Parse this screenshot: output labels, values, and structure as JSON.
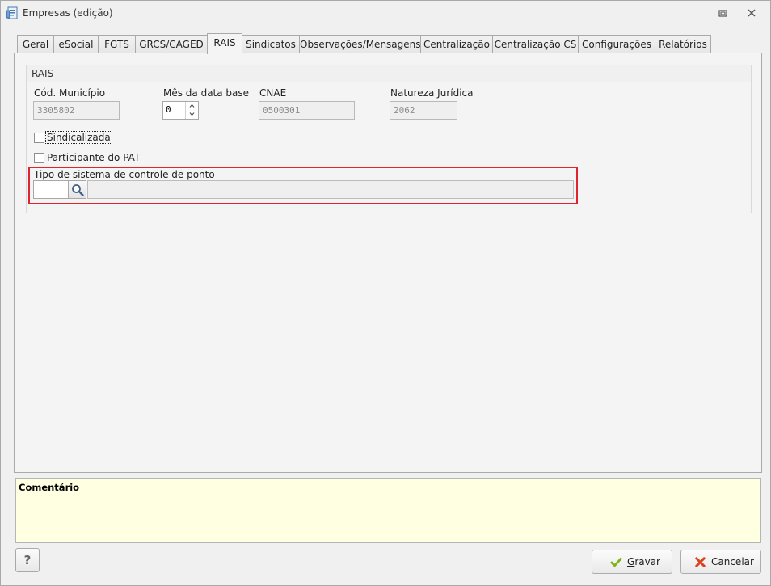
{
  "window": {
    "title": "Empresas (edição)",
    "icons": [
      "form-icon",
      "restore-icon",
      "close-icon"
    ]
  },
  "tabs": [
    {
      "label": "Geral"
    },
    {
      "label": "eSocial"
    },
    {
      "label": "FGTS"
    },
    {
      "label": "GRCS/CAGED"
    },
    {
      "label": "RAIS",
      "active": true
    },
    {
      "label": "Sindicatos"
    },
    {
      "label": "Observações/Mensagens"
    },
    {
      "label": "Centralização"
    },
    {
      "label": "Centralização CS"
    },
    {
      "label": "Configurações"
    },
    {
      "label": "Relatórios"
    }
  ],
  "rais": {
    "group_title": "RAIS",
    "cod_municipio": {
      "label": "Cód. Município",
      "value": "3305802"
    },
    "mes_data_base": {
      "label": "Mês da data base",
      "value": "0"
    },
    "cnae": {
      "label": "CNAE",
      "value": "0500301"
    },
    "natureza_juridica": {
      "label": "Natureza Jurídica",
      "value": "2062"
    },
    "sindicalizada": {
      "label": "Sindicalizada",
      "checked": false
    },
    "participante_pat": {
      "label": "Participante do PAT",
      "checked": false
    },
    "tipo_sistema_ponto": {
      "label": "Tipo de sistema de controle de ponto",
      "code": "",
      "description": ""
    }
  },
  "comment": {
    "title": "Comentário",
    "text": ""
  },
  "footer": {
    "help_label": "?",
    "save_label_prefix": "",
    "save_accel": "G",
    "save_label_rest": "ravar",
    "cancel_label": "Cancelar"
  },
  "colors": {
    "highlight": "#e0242d",
    "comment_bg": "#ffffe1",
    "save_icon": "#7cb518",
    "cancel_icon": "#d9431e"
  }
}
